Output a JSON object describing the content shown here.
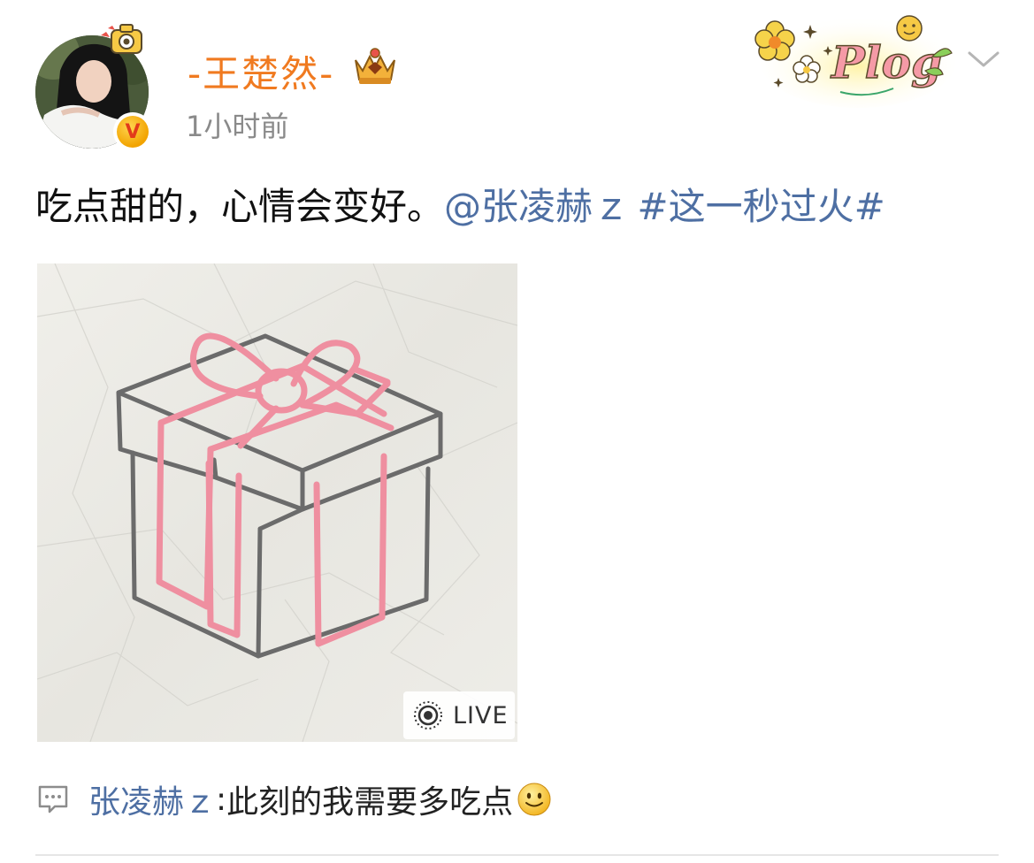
{
  "post": {
    "username_prefix": "-",
    "username": "王楚然",
    "username_suffix": "-",
    "timestamp": "1小时前",
    "text": "吃点甜的，心情会变好。",
    "mention": "@张凌赫ｚ",
    "hashtag": "#这一秒过火#",
    "plog_sticker_text": "Plog",
    "live_label": "LIVE"
  },
  "comment": {
    "author": "张凌赫ｚ",
    "separator": ":",
    "text": " 此刻的我需要多吃点"
  },
  "icons": {
    "verified": "verified-v-icon",
    "crown": "crown-badge-icon",
    "dropdown": "chevron-down-icon",
    "live": "live-photo-icon",
    "comment": "comment-bubble-icon",
    "emoji": "smile-emoji-icon"
  },
  "colors": {
    "username": "#f07a20",
    "link": "#4e6fa3",
    "timestamp": "#8a8a8a",
    "ribbon": "#ef8fa0",
    "box_outline": "#6b6b6b"
  }
}
